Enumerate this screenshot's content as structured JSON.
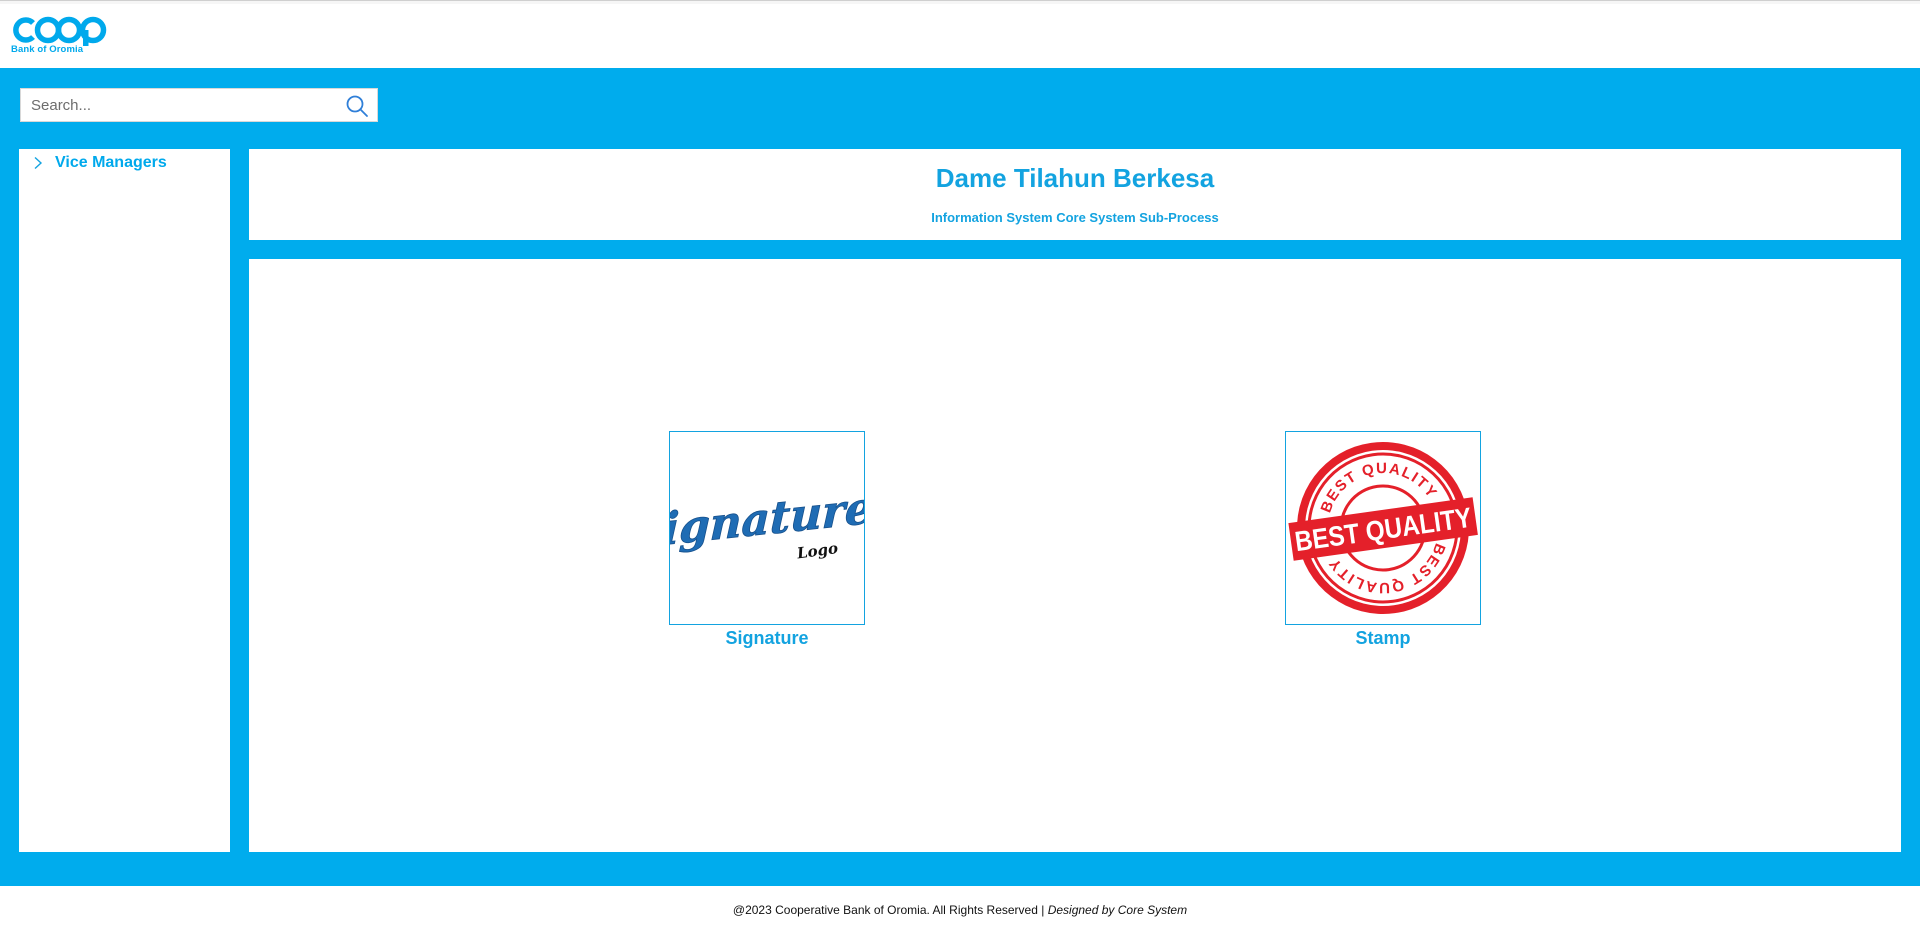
{
  "brand": {
    "logo_text": "coop",
    "logo_subtitle": "Bank of Oromia",
    "color": "#00a9ec"
  },
  "search": {
    "placeholder": "Search...",
    "value": "",
    "icon": "search-icon"
  },
  "sidebar": {
    "items": [
      {
        "label": "Vice Managers",
        "icon": "chevron-right-icon",
        "expanded": false
      }
    ]
  },
  "profile": {
    "name": "Dame Tilahun Berkesa",
    "department": "Information System Core System Sub-Process"
  },
  "documents": [
    {
      "caption": "Signature",
      "image_text": [
        "Signature",
        "Logo"
      ]
    },
    {
      "caption": "Stamp",
      "image_text": [
        "BEST QUALITY",
        "BEST QUALITY",
        "BEST QUALITY"
      ]
    }
  ],
  "footer": {
    "copyright": "@2023 Cooperative Bank of Oromia. All Rights Reserved |",
    "designed_by": "Designed by Core System"
  },
  "colors": {
    "primary_blue": "#00aced",
    "text_blue": "#13a3e0",
    "stamp_red": "#e4202a"
  }
}
